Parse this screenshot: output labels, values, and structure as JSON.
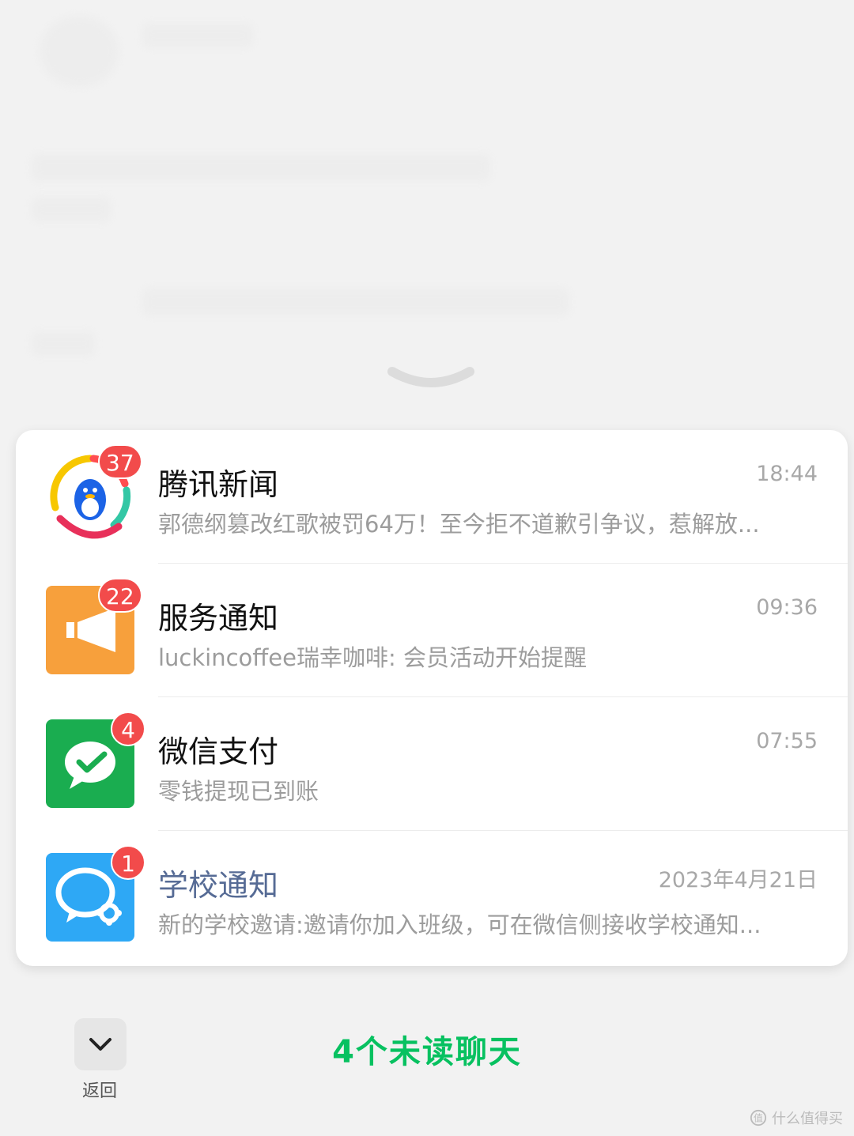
{
  "chats": [
    {
      "name": "腾讯新闻",
      "time": "18:44",
      "preview": "郭德纲篡改红歌被罚64万！至今拒不道歉引争议，惹解放...",
      "badge": "37",
      "icon": "tencent-news-icon"
    },
    {
      "name": "服务通知",
      "time": "09:36",
      "preview": "luckincoffee瑞幸咖啡: 会员活动开始提醒",
      "badge": "22",
      "icon": "megaphone-icon",
      "avatar_color": "#f7a03c"
    },
    {
      "name": "微信支付",
      "time": "07:55",
      "preview": "零钱提现已到账",
      "badge": "4",
      "icon": "wechat-pay-icon",
      "avatar_color": "#1aad50"
    },
    {
      "name": "学校通知",
      "time": "2023年4月21日",
      "preview": "新的学校邀请:邀请你加入班级，可在微信侧接收学校通知...",
      "badge": "1",
      "icon": "school-chat-icon",
      "avatar_color": "#2ea8f5"
    }
  ],
  "footer": {
    "back_label": "返回",
    "unread_text": "4个未读聊天"
  },
  "watermark": "什么值得买",
  "colors": {
    "accent": "#07c160",
    "badge": "#f24b4b",
    "school_title": "#566b95"
  }
}
